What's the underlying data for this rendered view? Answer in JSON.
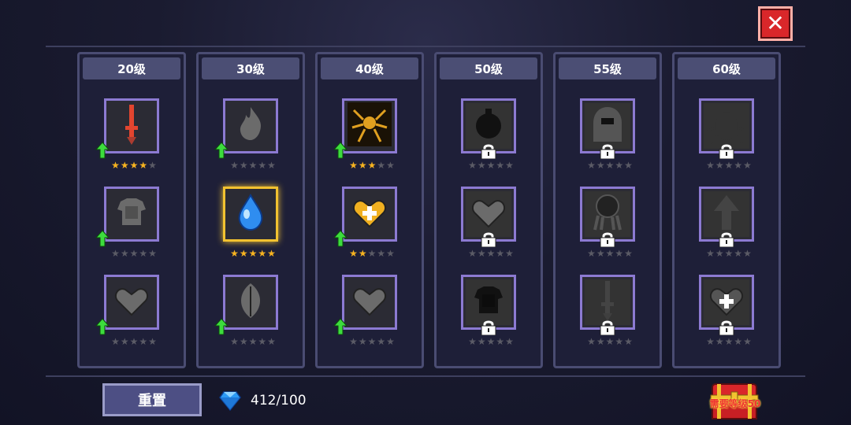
{
  "header": {
    "close_icon": "close-icon"
  },
  "columns": [
    {
      "label": "20级",
      "slots": [
        {
          "icon": "sword-icon",
          "stars": 4,
          "locked": false,
          "upgrade": true,
          "color": "#e2452f"
        },
        {
          "icon": "armor-icon",
          "stars": 0,
          "locked": false,
          "upgrade": true,
          "color": "#6b6b6b"
        },
        {
          "icon": "heart-icon",
          "stars": 0,
          "locked": false,
          "upgrade": true,
          "color": "#6b6b6b"
        }
      ]
    },
    {
      "label": "30级",
      "slots": [
        {
          "icon": "flame-icon",
          "stars": 0,
          "locked": false,
          "upgrade": true,
          "color": "#6b6b6b"
        },
        {
          "icon": "water-drop-icon",
          "stars": 5,
          "locked": false,
          "upgrade": false,
          "color": "#2f8df0",
          "highlight": true
        },
        {
          "icon": "leaf-icon",
          "stars": 0,
          "locked": false,
          "upgrade": true,
          "color": "#6b6b6b"
        }
      ]
    },
    {
      "label": "40级",
      "slots": [
        {
          "icon": "spider-icon",
          "stars": 3,
          "locked": false,
          "upgrade": true,
          "color": "#e0a020"
        },
        {
          "icon": "heart-plus-icon",
          "stars": 2,
          "locked": false,
          "upgrade": true,
          "color": "#f0b020"
        },
        {
          "icon": "heart-icon",
          "stars": 0,
          "locked": false,
          "upgrade": true,
          "color": "#6b6b6b"
        }
      ]
    },
    {
      "label": "50级",
      "slots": [
        {
          "icon": "bomb-icon",
          "stars": 0,
          "locked": true,
          "upgrade": false,
          "color": "#111"
        },
        {
          "icon": "heart-icon",
          "stars": 0,
          "locked": true,
          "upgrade": false,
          "color": "#6b6b6b"
        },
        {
          "icon": "armor-icon",
          "stars": 0,
          "locked": true,
          "upgrade": false,
          "color": "#111"
        }
      ]
    },
    {
      "label": "55级",
      "slots": [
        {
          "icon": "hooded-figure-icon",
          "stars": 0,
          "locked": true,
          "upgrade": false,
          "color": "#555"
        },
        {
          "icon": "octopus-icon",
          "stars": 0,
          "locked": true,
          "upgrade": false,
          "color": "#222"
        },
        {
          "icon": "sword-icon",
          "stars": 0,
          "locked": true,
          "upgrade": false,
          "color": "#444"
        }
      ]
    },
    {
      "label": "60级",
      "slots": [
        {
          "icon": "beetle-icon",
          "stars": 0,
          "locked": true,
          "upgrade": false,
          "color": "#333"
        },
        {
          "icon": "up-arrow-icon",
          "stars": 0,
          "locked": true,
          "upgrade": false,
          "color": "#444"
        },
        {
          "icon": "heart-plus-icon",
          "stars": 0,
          "locked": true,
          "upgrade": false,
          "color": "#555"
        }
      ]
    }
  ],
  "footer": {
    "reset_label": "重置",
    "gem_count": "412/100",
    "gem_icon": "diamond-icon",
    "chest_label": "需要等级50",
    "chest_icon": "treasure-chest-icon"
  },
  "colors": {
    "star_on": "#f7b320",
    "star_off": "#5b5b66",
    "upgrade_arrow": "#3ddc3d",
    "slot_border": "#8c7ad2",
    "highlight_border": "#f2c230"
  }
}
